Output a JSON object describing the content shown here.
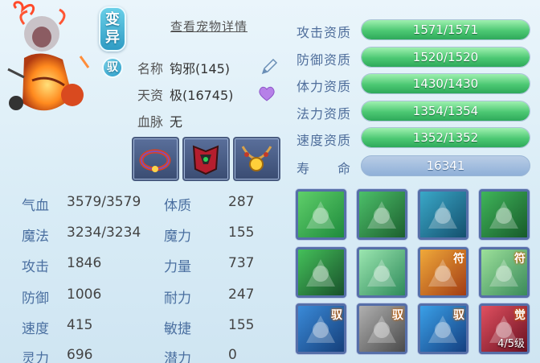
{
  "header": {
    "variant_badge": "变\n异",
    "variant_text_top": "变",
    "variant_text_bottom": "异",
    "yu_badge": "驭",
    "detail_link": "查看宠物详情"
  },
  "pet": {
    "name_label": "名称",
    "name_value": "钩邪(145)",
    "talent_label": "天资",
    "talent_value": "极(16745)",
    "bloodline_label": "血脉",
    "bloodline_value": "无"
  },
  "equipment": [
    {
      "name": "collar-ring"
    },
    {
      "name": "armor-piece"
    },
    {
      "name": "necklace"
    }
  ],
  "attributes": [
    {
      "label": "气血",
      "value": "3579/3579"
    },
    {
      "label": "体质",
      "value": "287"
    },
    {
      "label": "魔法",
      "value": "3234/3234"
    },
    {
      "label": "魔力",
      "value": "155"
    },
    {
      "label": "攻击",
      "value": "1846"
    },
    {
      "label": "力量",
      "value": "737"
    },
    {
      "label": "防御",
      "value": "1006"
    },
    {
      "label": "耐力",
      "value": "247"
    },
    {
      "label": "速度",
      "value": "415"
    },
    {
      "label": "敏捷",
      "value": "155"
    },
    {
      "label": "灵力",
      "value": "696"
    },
    {
      "label": "潜力",
      "value": "0"
    }
  ],
  "aptitudes": [
    {
      "label": "攻击资质",
      "text": "1571/1571",
      "fill": 1.0
    },
    {
      "label": "防御资质",
      "text": "1520/1520",
      "fill": 1.0
    },
    {
      "label": "体力资质",
      "text": "1430/1430",
      "fill": 1.0
    },
    {
      "label": "法力资质",
      "text": "1354/1354",
      "fill": 1.0
    },
    {
      "label": "速度资质",
      "text": "1352/1352",
      "fill": 1.0
    }
  ],
  "life": {
    "label": "寿　　命",
    "value": "16341"
  },
  "skills": [
    {
      "icon": "sword-skill-icon",
      "tag": "",
      "level": ""
    },
    {
      "icon": "green-warrior-skill-icon",
      "tag": "",
      "level": ""
    },
    {
      "icon": "shadow-figure-skill-icon",
      "tag": "",
      "level": ""
    },
    {
      "icon": "knight-skill-icon",
      "tag": "",
      "level": ""
    },
    {
      "icon": "green-fist-skill-icon",
      "tag": "",
      "level": ""
    },
    {
      "icon": "shatter-skill-icon",
      "tag": "",
      "level": ""
    },
    {
      "icon": "talisman-skill-icon",
      "tag": "符",
      "level": ""
    },
    {
      "icon": "heart-talisman-skill-icon",
      "tag": "符",
      "level": ""
    },
    {
      "icon": "wave-kick-skill-icon",
      "tag": "驭",
      "level": ""
    },
    {
      "icon": "stone-fist-skill-icon",
      "tag": "驭",
      "level": ""
    },
    {
      "icon": "runner-skill-icon",
      "tag": "驭",
      "level": ""
    },
    {
      "icon": "awaken-skill-icon",
      "tag": "觉",
      "level": "4/5级"
    }
  ],
  "colors": {
    "accent": "#2f9cc4",
    "bar_green": "#4cc873",
    "label_blue": "#4a6fa0"
  }
}
